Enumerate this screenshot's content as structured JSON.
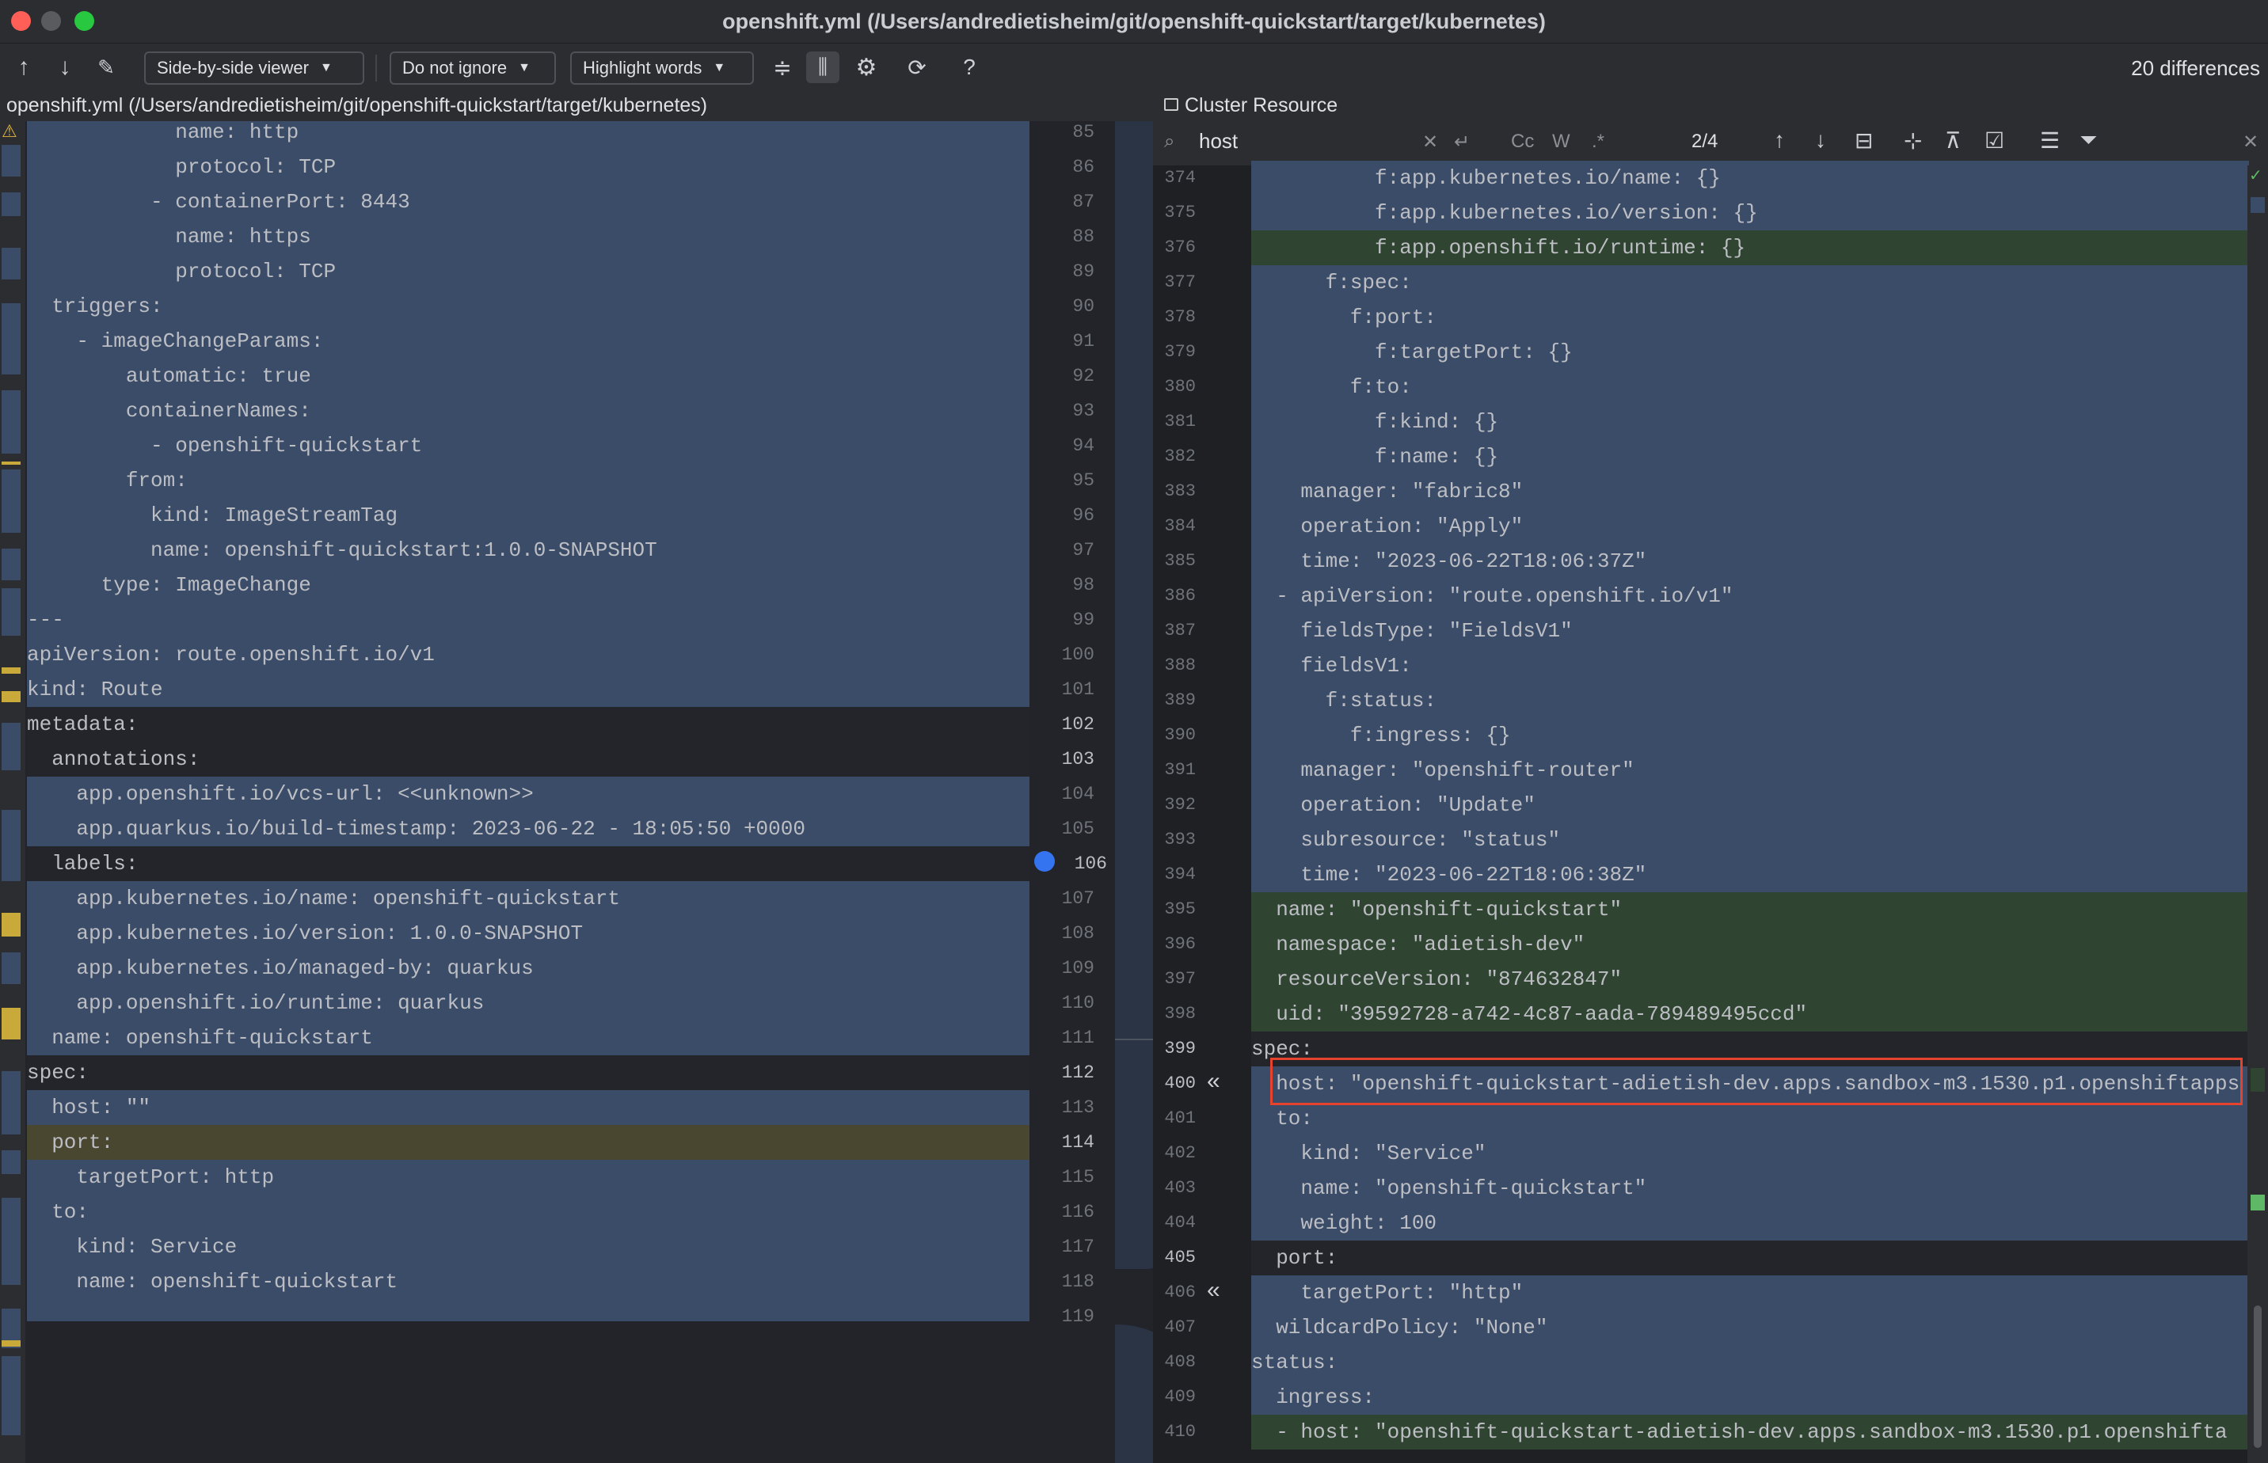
{
  "window": {
    "title": "openshift.yml (/Users/andredietisheim/git/openshift-quickstart/target/kubernetes)"
  },
  "toolbar": {
    "viewer": "Side-by-side viewer",
    "ignore": "Do not ignore",
    "highlight": "Highlight words",
    "help": "?",
    "differences": "20 differences"
  },
  "left": {
    "path": "openshift.yml (/Users/andredietisheim/git/openshift-quickstart/target/kubernetes)"
  },
  "right": {
    "title": "Cluster Resource"
  },
  "search": {
    "value": "host",
    "match": "2/4",
    "cc": "Cc",
    "w": "W",
    "regex": ".*"
  },
  "left_lines": [
    {
      "n": "85",
      "code": "            name: http"
    },
    {
      "n": "86",
      "code": "            protocol: TCP"
    },
    {
      "n": "87",
      "code": "          - containerPort: 8443"
    },
    {
      "n": "88",
      "code": "            name: https"
    },
    {
      "n": "89",
      "code": "            protocol: TCP"
    },
    {
      "n": "90",
      "code": "  triggers:"
    },
    {
      "n": "91",
      "code": "    - imageChangeParams:"
    },
    {
      "n": "92",
      "code": "        automatic: true"
    },
    {
      "n": "93",
      "code": "        containerNames:"
    },
    {
      "n": "94",
      "code": "          - openshift-quickstart"
    },
    {
      "n": "95",
      "code": "        from:"
    },
    {
      "n": "96",
      "code": "          kind: ImageStreamTag"
    },
    {
      "n": "97",
      "code": "          name: openshift-quickstart:1.0.0-SNAPSHOT"
    },
    {
      "n": "98",
      "code": "      type: ImageChange"
    },
    {
      "n": "99",
      "code": "---"
    },
    {
      "n": "100",
      "code": "apiVersion: route.openshift.io/v1"
    },
    {
      "n": "101",
      "code": "kind: Route"
    },
    {
      "n": "102",
      "code": "metadata:"
    },
    {
      "n": "103",
      "code": "  annotations:"
    },
    {
      "n": "104",
      "code": "    app.openshift.io/vcs-url: <<unknown>>"
    },
    {
      "n": "105",
      "code": "    app.quarkus.io/build-timestamp: 2023-06-22 - 18:05:50 +0000"
    },
    {
      "n": "106",
      "code": "  labels:"
    },
    {
      "n": "107",
      "code": "    app.kubernetes.io/name: openshift-quickstart"
    },
    {
      "n": "108",
      "code": "    app.kubernetes.io/version: 1.0.0-SNAPSHOT"
    },
    {
      "n": "109",
      "code": "    app.kubernetes.io/managed-by: quarkus"
    },
    {
      "n": "110",
      "code": "    app.openshift.io/runtime: quarkus"
    },
    {
      "n": "111",
      "code": "  name: openshift-quickstart"
    },
    {
      "n": "112",
      "code": "spec:"
    },
    {
      "n": "113",
      "code": "  host: \"\""
    },
    {
      "n": "114",
      "code": "  port:"
    },
    {
      "n": "115",
      "code": "    targetPort: http"
    },
    {
      "n": "116",
      "code": "  to:"
    },
    {
      "n": "117",
      "code": "    kind: Service"
    },
    {
      "n": "118",
      "code": "    name: openshift-quickstart"
    },
    {
      "n": "119",
      "code": ""
    }
  ],
  "right_lines": [
    {
      "n": "374",
      "code": "          f:app.kubernetes.io/name: {}"
    },
    {
      "n": "375",
      "code": "          f:app.kubernetes.io/version: {}"
    },
    {
      "n": "376",
      "code": "          f:app.openshift.io/runtime: {}"
    },
    {
      "n": "377",
      "code": "      f:spec:"
    },
    {
      "n": "378",
      "code": "        f:port:"
    },
    {
      "n": "379",
      "code": "          f:targetPort: {}"
    },
    {
      "n": "380",
      "code": "        f:to:"
    },
    {
      "n": "381",
      "code": "          f:kind: {}"
    },
    {
      "n": "382",
      "code": "          f:name: {}"
    },
    {
      "n": "383",
      "code": "    manager: \"fabric8\""
    },
    {
      "n": "384",
      "code": "    operation: \"Apply\""
    },
    {
      "n": "385",
      "code": "    time: \"2023-06-22T18:06:37Z\""
    },
    {
      "n": "386",
      "code": "  - apiVersion: \"route.openshift.io/v1\""
    },
    {
      "n": "387",
      "code": "    fieldsType: \"FieldsV1\""
    },
    {
      "n": "388",
      "code": "    fieldsV1:"
    },
    {
      "n": "389",
      "code": "      f:status:"
    },
    {
      "n": "390",
      "code": "        f:ingress: {}"
    },
    {
      "n": "391",
      "code": "    manager: \"openshift-router\""
    },
    {
      "n": "392",
      "code": "    operation: \"Update\""
    },
    {
      "n": "393",
      "code": "    subresource: \"status\""
    },
    {
      "n": "394",
      "code": "    time: \"2023-06-22T18:06:38Z\""
    },
    {
      "n": "395",
      "code": "  name: \"openshift-quickstart\""
    },
    {
      "n": "396",
      "code": "  namespace: \"adietish-dev\""
    },
    {
      "n": "397",
      "code": "  resourceVersion: \"874632847\""
    },
    {
      "n": "398",
      "code": "  uid: \"39592728-a742-4c87-aada-789489495ccd\""
    },
    {
      "n": "399",
      "code": "spec:"
    },
    {
      "n": "400",
      "code": "  host: \"openshift-quickstart-adietish-dev.apps.sandbox-m3.1530.p1.openshiftapps"
    },
    {
      "n": "401",
      "code": "  to:"
    },
    {
      "n": "402",
      "code": "    kind: \"Service\""
    },
    {
      "n": "403",
      "code": "    name: \"openshift-quickstart\""
    },
    {
      "n": "404",
      "code": "    weight: 100"
    },
    {
      "n": "405",
      "code": "  port:"
    },
    {
      "n": "406",
      "code": "    targetPort: \"http\""
    },
    {
      "n": "407",
      "code": "  wildcardPolicy: \"None\""
    },
    {
      "n": "408",
      "code": "status:"
    },
    {
      "n": "409",
      "code": "  ingress:"
    },
    {
      "n": "410",
      "code": "  - host: \"openshift-quickstart-adietish-dev.apps.sandbox-m3.1530.p1.openshifta"
    }
  ]
}
